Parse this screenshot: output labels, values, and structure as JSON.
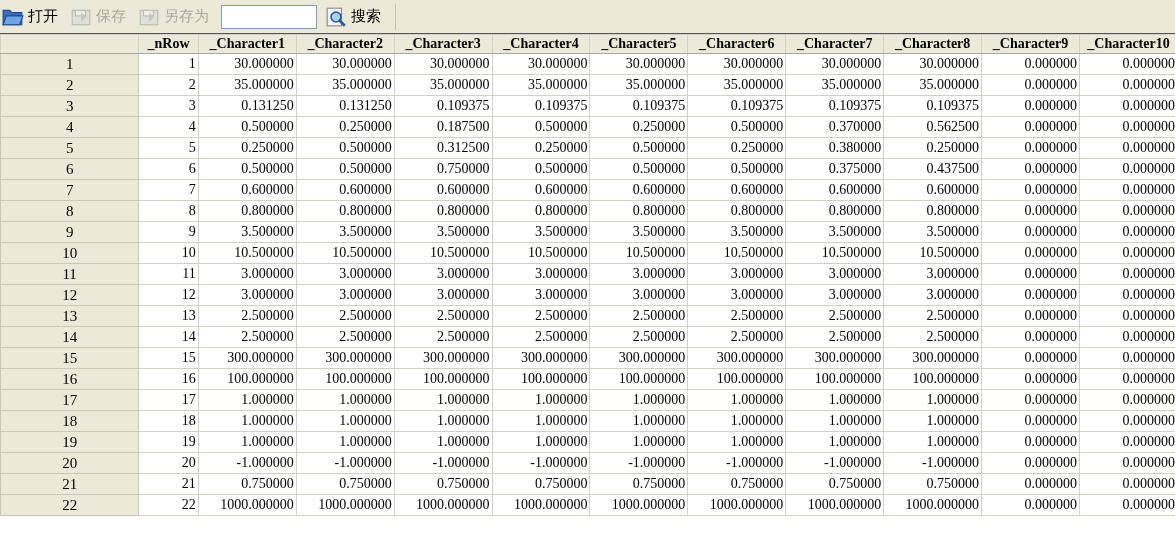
{
  "toolbar": {
    "buttons": [
      {
        "label": "打开",
        "kind": "open",
        "disabled": false
      },
      {
        "label": "保存",
        "kind": "save",
        "disabled": true
      },
      {
        "label": "另存为",
        "kind": "saveas",
        "disabled": true
      }
    ],
    "search_button": {
      "label": "搜索"
    }
  },
  "table": {
    "columns": [
      "_nRow",
      "_Character1",
      "_Character2",
      "_Character3",
      "_Character4",
      "_Character5",
      "_Character6",
      "_Character7",
      "_Character8",
      "_Character9",
      "_Character10"
    ],
    "rows": [
      {
        "header": "1",
        "cells": [
          "1",
          "30.000000",
          "30.000000",
          "30.000000",
          "30.000000",
          "30.000000",
          "30.000000",
          "30.000000",
          "30.000000",
          "0.000000",
          "0.000000"
        ]
      },
      {
        "header": "2",
        "cells": [
          "2",
          "35.000000",
          "35.000000",
          "35.000000",
          "35.000000",
          "35.000000",
          "35.000000",
          "35.000000",
          "35.000000",
          "0.000000",
          "0.000000"
        ]
      },
      {
        "header": "3",
        "cells": [
          "3",
          "0.131250",
          "0.131250",
          "0.109375",
          "0.109375",
          "0.109375",
          "0.109375",
          "0.109375",
          "0.109375",
          "0.000000",
          "0.000000"
        ]
      },
      {
        "header": "4",
        "cells": [
          "4",
          "0.500000",
          "0.250000",
          "0.187500",
          "0.500000",
          "0.250000",
          "0.500000",
          "0.370000",
          "0.562500",
          "0.000000",
          "0.000000"
        ]
      },
      {
        "header": "5",
        "cells": [
          "5",
          "0.250000",
          "0.500000",
          "0.312500",
          "0.250000",
          "0.500000",
          "0.250000",
          "0.380000",
          "0.250000",
          "0.000000",
          "0.000000"
        ]
      },
      {
        "header": "6",
        "cells": [
          "6",
          "0.500000",
          "0.500000",
          "0.750000",
          "0.500000",
          "0.500000",
          "0.500000",
          "0.375000",
          "0.437500",
          "0.000000",
          "0.000000"
        ]
      },
      {
        "header": "7",
        "cells": [
          "7",
          "0.600000",
          "0.600000",
          "0.600000",
          "0.600000",
          "0.600000",
          "0.600000",
          "0.600000",
          "0.600000",
          "0.000000",
          "0.000000"
        ]
      },
      {
        "header": "8",
        "cells": [
          "8",
          "0.800000",
          "0.800000",
          "0.800000",
          "0.800000",
          "0.800000",
          "0.800000",
          "0.800000",
          "0.800000",
          "0.000000",
          "0.000000"
        ]
      },
      {
        "header": "9",
        "cells": [
          "9",
          "3.500000",
          "3.500000",
          "3.500000",
          "3.500000",
          "3.500000",
          "3.500000",
          "3.500000",
          "3.500000",
          "0.000000",
          "0.000000"
        ]
      },
      {
        "header": "10",
        "cells": [
          "10",
          "10.500000",
          "10.500000",
          "10.500000",
          "10.500000",
          "10.500000",
          "10.500000",
          "10.500000",
          "10.500000",
          "0.000000",
          "0.000000"
        ]
      },
      {
        "header": "11",
        "cells": [
          "11",
          "3.000000",
          "3.000000",
          "3.000000",
          "3.000000",
          "3.000000",
          "3.000000",
          "3.000000",
          "3.000000",
          "0.000000",
          "0.000000"
        ]
      },
      {
        "header": "12",
        "cells": [
          "12",
          "3.000000",
          "3.000000",
          "3.000000",
          "3.000000",
          "3.000000",
          "3.000000",
          "3.000000",
          "3.000000",
          "0.000000",
          "0.000000"
        ]
      },
      {
        "header": "13",
        "cells": [
          "13",
          "2.500000",
          "2.500000",
          "2.500000",
          "2.500000",
          "2.500000",
          "2.500000",
          "2.500000",
          "2.500000",
          "0.000000",
          "0.000000"
        ]
      },
      {
        "header": "14",
        "cells": [
          "14",
          "2.500000",
          "2.500000",
          "2.500000",
          "2.500000",
          "2.500000",
          "2.500000",
          "2.500000",
          "2.500000",
          "0.000000",
          "0.000000"
        ]
      },
      {
        "header": "15",
        "cells": [
          "15",
          "300.000000",
          "300.000000",
          "300.000000",
          "300.000000",
          "300.000000",
          "300.000000",
          "300.000000",
          "300.000000",
          "0.000000",
          "0.000000"
        ]
      },
      {
        "header": "16",
        "cells": [
          "16",
          "100.000000",
          "100.000000",
          "100.000000",
          "100.000000",
          "100.000000",
          "100.000000",
          "100.000000",
          "100.000000",
          "0.000000",
          "0.000000"
        ]
      },
      {
        "header": "17",
        "cells": [
          "17",
          "1.000000",
          "1.000000",
          "1.000000",
          "1.000000",
          "1.000000",
          "1.000000",
          "1.000000",
          "1.000000",
          "0.000000",
          "0.000000"
        ]
      },
      {
        "header": "18",
        "cells": [
          "18",
          "1.000000",
          "1.000000",
          "1.000000",
          "1.000000",
          "1.000000",
          "1.000000",
          "1.000000",
          "1.000000",
          "0.000000",
          "0.000000"
        ]
      },
      {
        "header": "19",
        "cells": [
          "19",
          "1.000000",
          "1.000000",
          "1.000000",
          "1.000000",
          "1.000000",
          "1.000000",
          "1.000000",
          "1.000000",
          "0.000000",
          "0.000000"
        ]
      },
      {
        "header": "20",
        "cells": [
          "20",
          "-1.000000",
          "-1.000000",
          "-1.000000",
          "-1.000000",
          "-1.000000",
          "-1.000000",
          "-1.000000",
          "-1.000000",
          "0.000000",
          "0.000000"
        ]
      },
      {
        "header": "21",
        "cells": [
          "21",
          "0.750000",
          "0.750000",
          "0.750000",
          "0.750000",
          "0.750000",
          "0.750000",
          "0.750000",
          "0.750000",
          "0.000000",
          "0.000000"
        ]
      },
      {
        "header": "22",
        "cells": [
          "22",
          "1000.000000",
          "1000.000000",
          "1000.000000",
          "1000.000000",
          "1000.000000",
          "1000.000000",
          "1000.000000",
          "1000.000000",
          "0.000000",
          "0.000000"
        ]
      }
    ]
  }
}
